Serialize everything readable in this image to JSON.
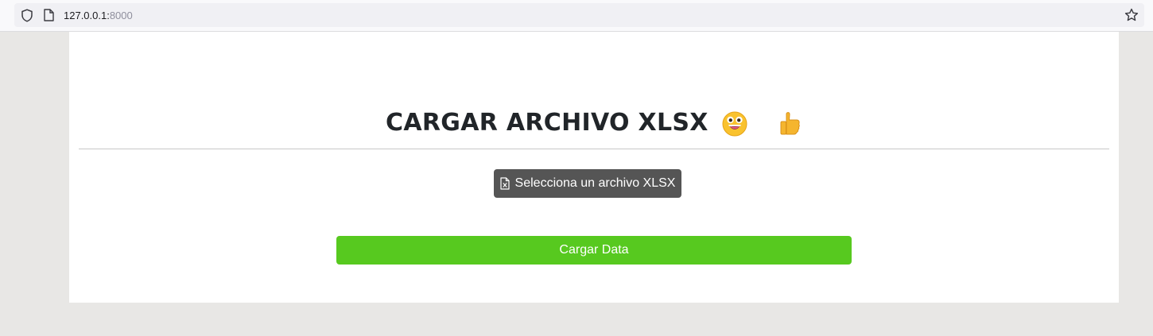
{
  "browser": {
    "url_host": "127.0.0.1:",
    "url_port": "8000"
  },
  "page": {
    "title": "CARGAR ARCHIVO XLSX",
    "title_emojis": [
      "grinning-face-icon",
      "thumbs-up-icon"
    ],
    "file_button_label": "Selecciona un archivo XLSX",
    "submit_button_label": "Cargar Data"
  },
  "colors": {
    "file_button_bg": "#555555",
    "submit_button_bg": "#57c91f",
    "page_bg": "#e8e7e5",
    "card_bg": "#ffffff"
  }
}
